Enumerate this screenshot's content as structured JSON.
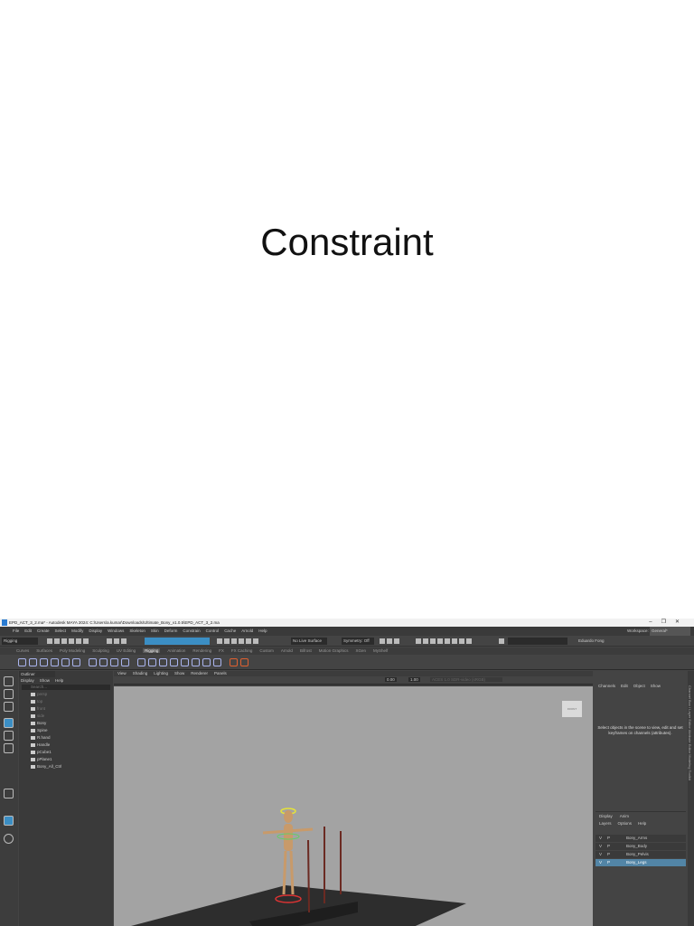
{
  "slide": {
    "title": "Constraint"
  },
  "window": {
    "title": "EPD_ACT_3_2.ma* - Autodesk MAYA 2024: C:\\Users\\a.kumar\\Downloads\\Ultimate_Bony_v1.0.5\\EPD_ACT_3_2.ma",
    "controls": [
      "–",
      "❐",
      "✕"
    ]
  },
  "menu": [
    "File",
    "Edit",
    "Create",
    "Select",
    "Modify",
    "Display",
    "Windows",
    "Skeleton",
    "Skin",
    "Deform",
    "Constrain",
    "Control",
    "Cache",
    "Arnold",
    "Help"
  ],
  "workspace": {
    "label": "Workspace:",
    "value": "General*"
  },
  "toolbar": {
    "mode": "Rigging",
    "live_surface": "No Live Surface",
    "symmetry": "Symmetry: Off",
    "user": "Eduardo Fong"
  },
  "shelf_tabs": [
    "Curves",
    "Surfaces",
    "Poly Modeling",
    "Sculpting",
    "UV Editing",
    "Rigging",
    "Animation",
    "Rendering",
    "FX",
    "FX Caching",
    "Custom",
    "Arnold",
    "Bifrost",
    "Motion Graphics",
    "XGen",
    "MyShelf"
  ],
  "shelf_active": "Rigging",
  "outliner": {
    "title": "Outliner",
    "menu": [
      "Display",
      "Show",
      "Help"
    ],
    "search_placeholder": "Search...",
    "items": [
      {
        "name": "persp",
        "type": "cam"
      },
      {
        "name": "top",
        "type": "cam"
      },
      {
        "name": "front",
        "type": "cam"
      },
      {
        "name": "side",
        "type": "cam"
      },
      {
        "name": "Bony",
        "type": "grp"
      },
      {
        "name": "Spine",
        "type": "child"
      },
      {
        "name": "R.hand",
        "type": "child"
      },
      {
        "name": "Handle",
        "type": "child"
      },
      {
        "name": "pCube1",
        "type": "child"
      },
      {
        "name": "pPlane1",
        "type": "child"
      },
      {
        "name": "Bony_All_Ctrl",
        "type": "grp"
      }
    ]
  },
  "viewport": {
    "menu": [
      "View",
      "Shading",
      "Lighting",
      "Show",
      "Renderer",
      "Panels"
    ],
    "field1": "0.00",
    "field2": "1.00",
    "colorspace": "ACES 1.0 SDR-video (sRGB)",
    "cube_label": "FRONT"
  },
  "channel_box": {
    "menu": [
      "Channels",
      "Edit",
      "Object",
      "Show"
    ],
    "message": "Select objects in the scene to view, edit and set keyframes on channels (attributes)."
  },
  "layers": {
    "tabs": [
      "Display",
      "Anim"
    ],
    "menu": [
      "Layers",
      "Options",
      "Help"
    ],
    "rows": [
      {
        "v": "V",
        "p": "P",
        "name": "Bony_Arms",
        "selected": false
      },
      {
        "v": "V",
        "p": "P",
        "name": "Bony_Body",
        "selected": false
      },
      {
        "v": "V",
        "p": "P",
        "name": "Bony_Pelvis",
        "selected": false
      },
      {
        "v": "V",
        "p": "P",
        "name": "Bony_Legs",
        "selected": true
      }
    ]
  },
  "side_tabs": "Channel Box / Layer Editor   Attribute Editor   Modeling Toolkit"
}
